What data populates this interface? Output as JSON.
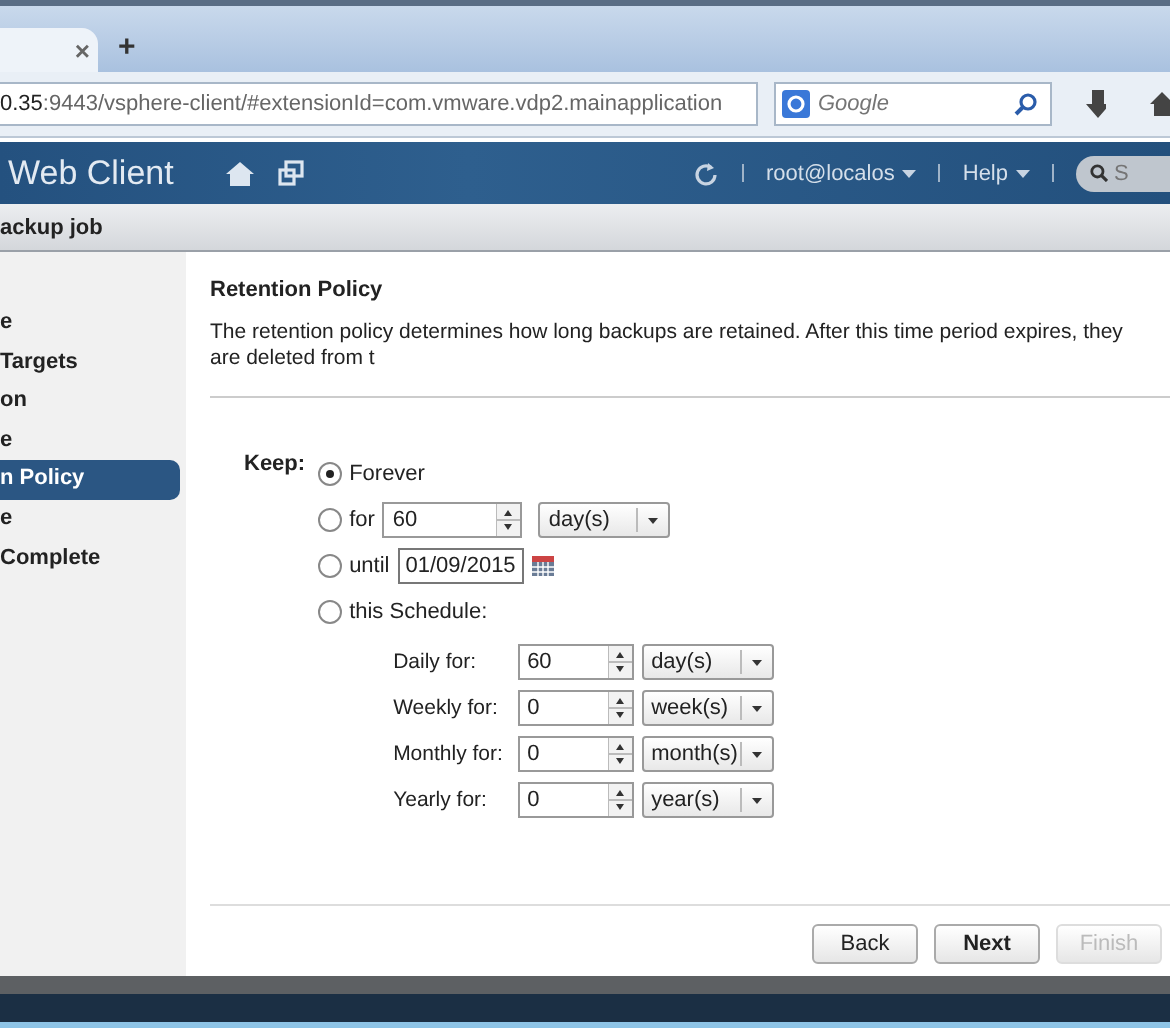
{
  "browser": {
    "tab_close": "×",
    "new_tab": "+",
    "url_host": "0.35",
    "url_rest": ":9443/vsphere-client/#extensionId=com.vmware.vdp2.mainapplication",
    "search_placeholder": "Google"
  },
  "app_header": {
    "title": "Web Client",
    "user": "root@localos",
    "help": "Help",
    "search_placeholder": "S"
  },
  "wizard_title": "ackup job",
  "sidebar": {
    "items": [
      {
        "label": "e",
        "selected": false
      },
      {
        "label": "Targets",
        "selected": false
      },
      {
        "label": "on",
        "selected": false
      },
      {
        "label": "e",
        "selected": false
      },
      {
        "label": "n Policy",
        "selected": true
      },
      {
        "label": "e",
        "selected": false
      },
      {
        "label": "Complete",
        "selected": false
      }
    ]
  },
  "section": {
    "title": "Retention Policy",
    "description": "The retention policy determines how long backups are retained.  After this time period expires, they are deleted from t"
  },
  "keep_label": "Keep:",
  "options": [
    {
      "kind": "plain",
      "label": "Forever",
      "selected": true
    },
    {
      "kind": "duration",
      "label": "for",
      "value": "60",
      "unit": "day(s)",
      "selected": false
    },
    {
      "kind": "date",
      "label": "until",
      "value": "01/09/2015",
      "selected": false
    },
    {
      "kind": "schedule",
      "label": "this Schedule:",
      "selected": false
    }
  ],
  "schedule": [
    {
      "label": "Daily for:",
      "value": "60",
      "unit": "day(s)"
    },
    {
      "label": "Weekly for:",
      "value": "0",
      "unit": "week(s)"
    },
    {
      "label": "Monthly for:",
      "value": "0",
      "unit": "month(s)"
    },
    {
      "label": "Yearly for:",
      "value": "0",
      "unit": "year(s)"
    }
  ],
  "buttons": [
    {
      "label": "Back",
      "disabled": false,
      "primary": false
    },
    {
      "label": "Next",
      "disabled": false,
      "primary": true
    },
    {
      "label": "Finish",
      "disabled": true,
      "primary": false
    }
  ]
}
